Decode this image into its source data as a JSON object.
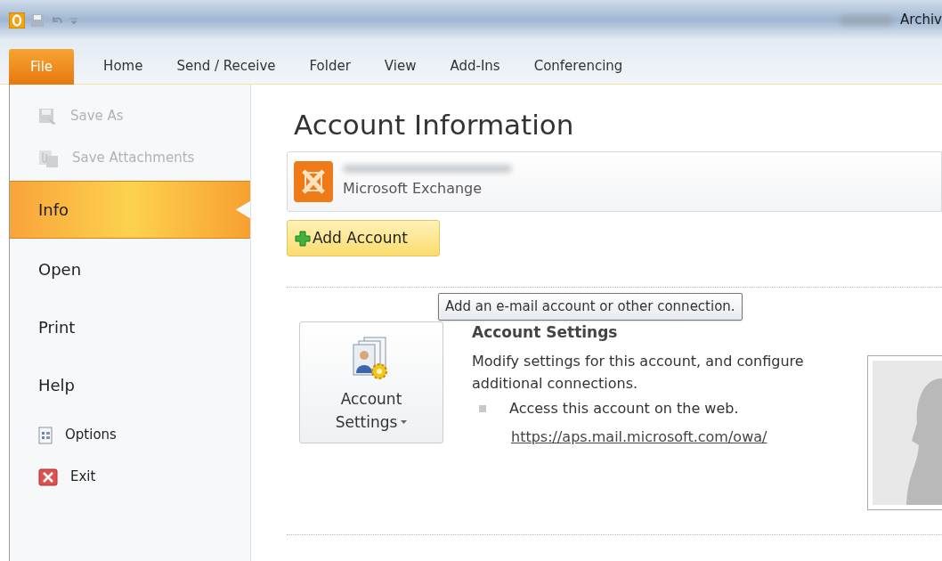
{
  "window": {
    "title": "Archiv"
  },
  "ribbon_tabs": [
    {
      "label": "File",
      "selected": true
    },
    {
      "label": "Home",
      "selected": false
    },
    {
      "label": "Send / Receive",
      "selected": false
    },
    {
      "label": "Folder",
      "selected": false
    },
    {
      "label": "View",
      "selected": false
    },
    {
      "label": "Add-Ins",
      "selected": false
    },
    {
      "label": "Conferencing",
      "selected": false
    }
  ],
  "sidebar": {
    "items": [
      {
        "label": "Save As",
        "kind": "command",
        "disabled": true,
        "selected": false
      },
      {
        "label": "Save Attachments",
        "kind": "command",
        "disabled": true,
        "selected": false
      },
      {
        "label": "Info",
        "kind": "page",
        "disabled": false,
        "selected": true
      },
      {
        "label": "Open",
        "kind": "page",
        "disabled": false,
        "selected": false
      },
      {
        "label": "Print",
        "kind": "page",
        "disabled": false,
        "selected": false
      },
      {
        "label": "Help",
        "kind": "page",
        "disabled": false,
        "selected": false
      },
      {
        "label": "Options",
        "kind": "command",
        "disabled": false,
        "selected": false
      },
      {
        "label": "Exit",
        "kind": "command",
        "disabled": false,
        "selected": false
      }
    ]
  },
  "main": {
    "title": "Account Information",
    "account": {
      "type": "Microsoft Exchange"
    },
    "add_account_button": "Add Account",
    "tooltip": "Add an e-mail account or other connection.",
    "account_settings": {
      "button_lines": [
        "Account",
        "Settings"
      ],
      "heading": "Account Settings",
      "description": "Modify settings for this account, and configure additional connections.",
      "bullet": "Access this account on the web.",
      "link": "https://aps.mail.microsoft.com/owa/"
    }
  }
}
